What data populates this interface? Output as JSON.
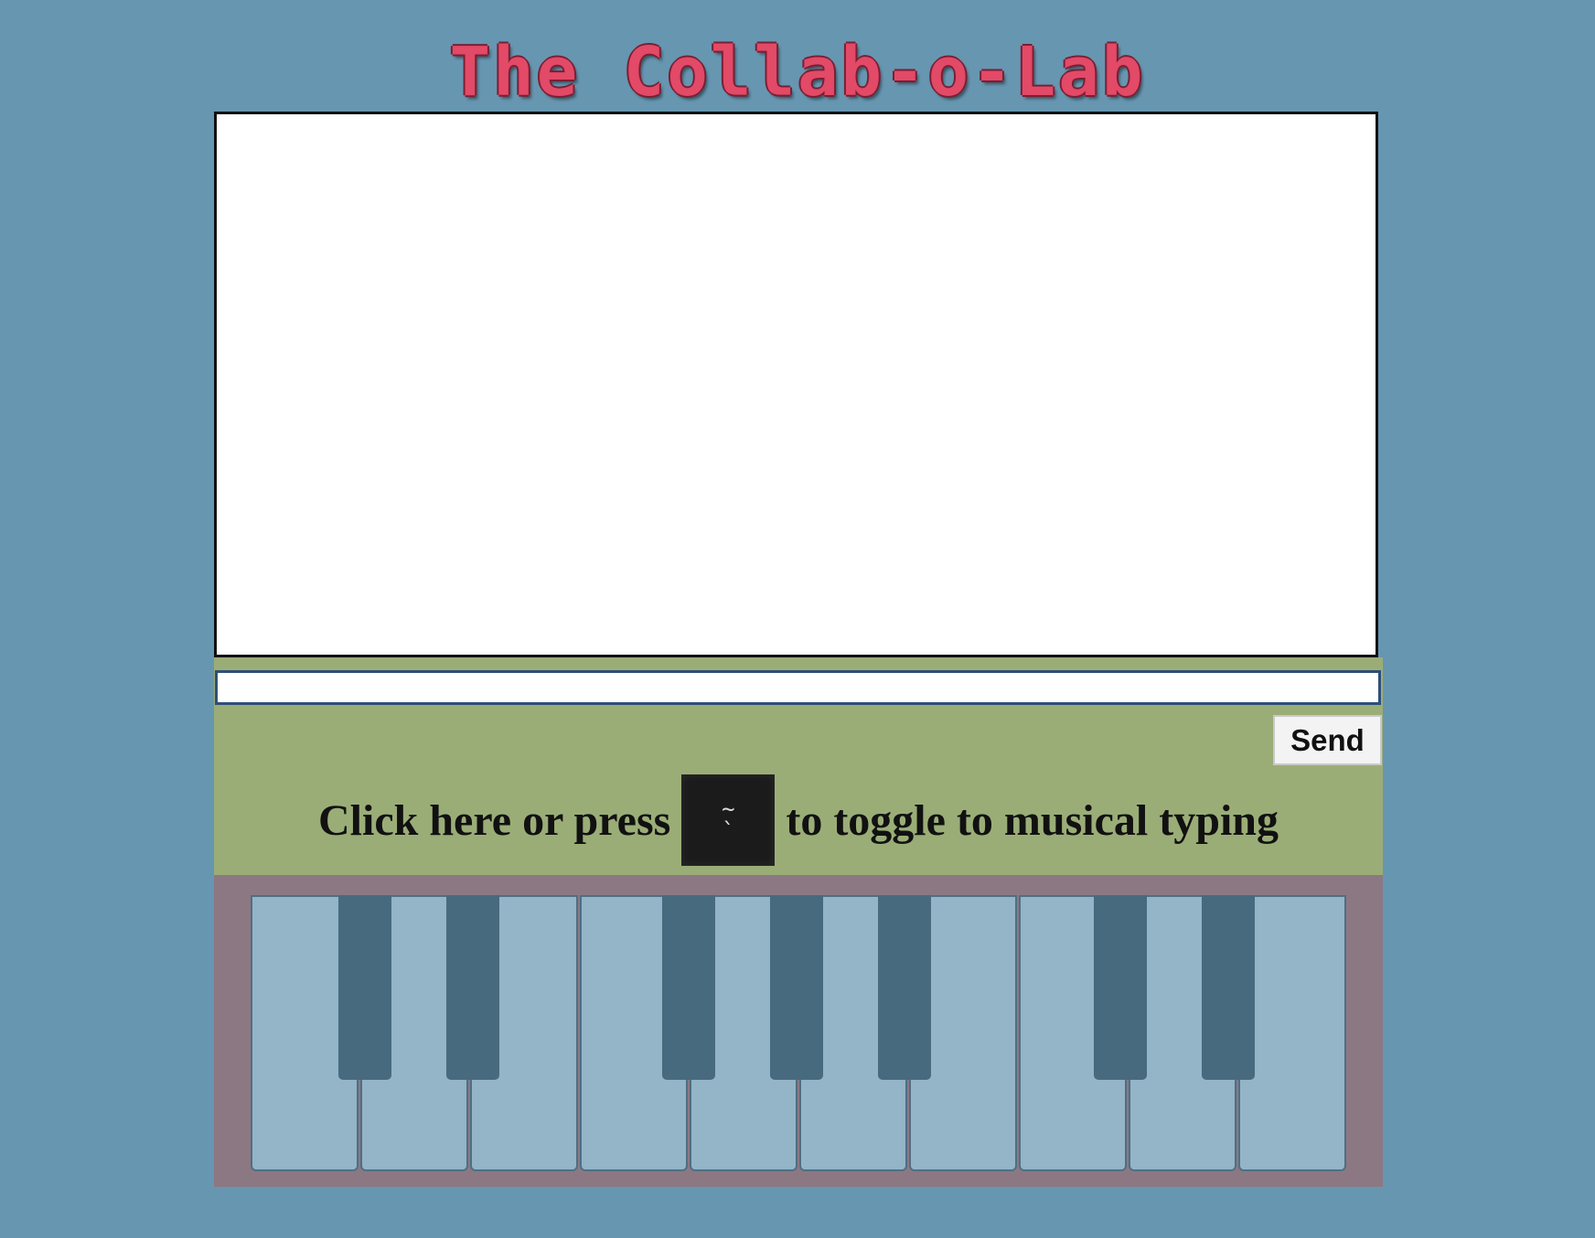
{
  "header": {
    "title": "The Collab-o-Lab"
  },
  "chat": {
    "messages": [],
    "input_value": "",
    "send_label": "Send"
  },
  "toggle": {
    "before_text": "Click here or press",
    "key_top": "~",
    "key_bottom": "`",
    "after_text": "to toggle to musical typing"
  },
  "piano": {
    "white_keys": 10,
    "black_keys": 7
  },
  "colors": {
    "background": "#6796b1",
    "title": "#e24a67",
    "chat_panel": "#9bad77",
    "piano_panel": "#8c7883",
    "white_key": "#94b4c8",
    "black_key": "#476a7e"
  }
}
